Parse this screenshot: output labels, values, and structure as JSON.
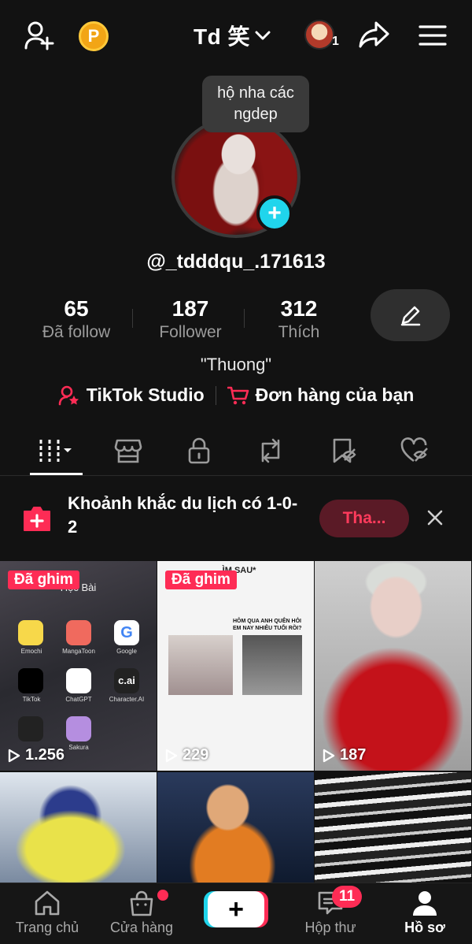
{
  "header": {
    "title": "Td 笑",
    "coin_label": "P",
    "friends_count": "1"
  },
  "profile": {
    "tooltip_line1": "hộ nha các",
    "tooltip_line2": "ngdep",
    "username": "@_tdddqu_.171613",
    "stats": [
      {
        "value": "65",
        "label": "Đã follow"
      },
      {
        "value": "187",
        "label": "Follower"
      },
      {
        "value": "312",
        "label": "Thích"
      }
    ],
    "bio": "\"Thuong\"",
    "links": {
      "studio": "TikTok Studio",
      "orders": "Đơn hàng của bạn"
    }
  },
  "banner": {
    "text": "Khoảnh khắc du lịch có 1-0-2",
    "button": "Tha..."
  },
  "videos": [
    {
      "pinned": "Đã ghim",
      "views": "1.256",
      "caption_top": "Học Bài"
    },
    {
      "pinned": "Đã ghim",
      "views": "229",
      "caption_top": "...ÌM SAU*",
      "caption_mid": "HÔM QUA ANH QUÊN HỎI EM NAY NHIÊU TUỔI RỒI?"
    },
    {
      "pinned": "",
      "views": "187"
    },
    {
      "pinned": "",
      "views": ""
    },
    {
      "pinned": "",
      "views": ""
    },
    {
      "pinned": "",
      "views": ""
    }
  ],
  "apps": [
    "Emochi",
    "MangaToon",
    "Google",
    "TikTok",
    "ChatGPT",
    "Character.AI",
    "",
    "Sakura"
  ],
  "nav": {
    "home": "Trang chủ",
    "shop": "Cửa hàng",
    "inbox": "Hộp thư",
    "inbox_count": "11",
    "profile": "Hồ sơ"
  },
  "colors": {
    "accent": "#fe2c55",
    "cyan": "#20d5ec",
    "background": "#121212"
  }
}
